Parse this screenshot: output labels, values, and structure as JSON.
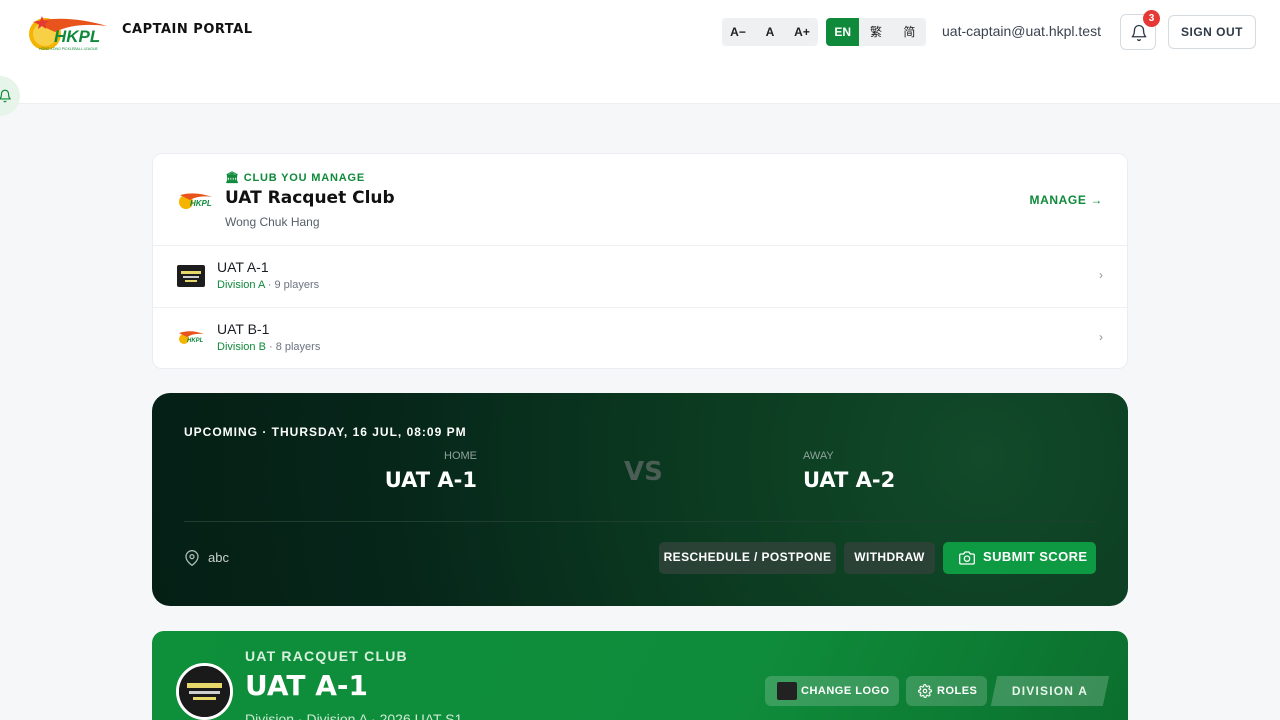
{
  "header": {
    "portal_title": "CAPTAIN PORTAL",
    "font_sizes": [
      "A−",
      "A",
      "A+"
    ],
    "languages": [
      "EN",
      "繁",
      "简"
    ],
    "active_language": "EN",
    "user_email": "uat-captain@uat.hkpl.test",
    "notification_count": "3",
    "sign_out_label": "SIGN OUT"
  },
  "club": {
    "eyebrow": "CLUB YOU MANAGE",
    "name": "UAT Racquet Club",
    "location": "Wong Chuk Hang",
    "manage_label": "MANAGE →",
    "teams": [
      {
        "name": "UAT A-1",
        "division": "Division A",
        "players": "· 9 players"
      },
      {
        "name": "UAT B-1",
        "division": "Division B",
        "players": "· 8 players"
      }
    ]
  },
  "match": {
    "eyebrow": "UPCOMING · THURSDAY, 16 JUL, 08:09 PM",
    "home_label": "HOME",
    "home_team": "UAT A-1",
    "vs": "VS",
    "away_label": "AWAY",
    "away_team": "UAT A-2",
    "venue": "abc",
    "reschedule_label": "RESCHEDULE / POSTPONE",
    "withdraw_label": "WITHDRAW",
    "submit_label": "SUBMIT SCORE"
  },
  "team_banner": {
    "club": "UAT RACQUET CLUB",
    "team": "UAT A-1",
    "subtitle": "Division · Division A · 2026 UAT S1",
    "change_logo_label": "CHANGE LOGO",
    "roles_label": "ROLES",
    "division_tag": "DIVISION A"
  },
  "colors": {
    "brand_green": "#0e8a3a",
    "match_card_bg": "#06261a",
    "badge_red": "#e53935"
  }
}
